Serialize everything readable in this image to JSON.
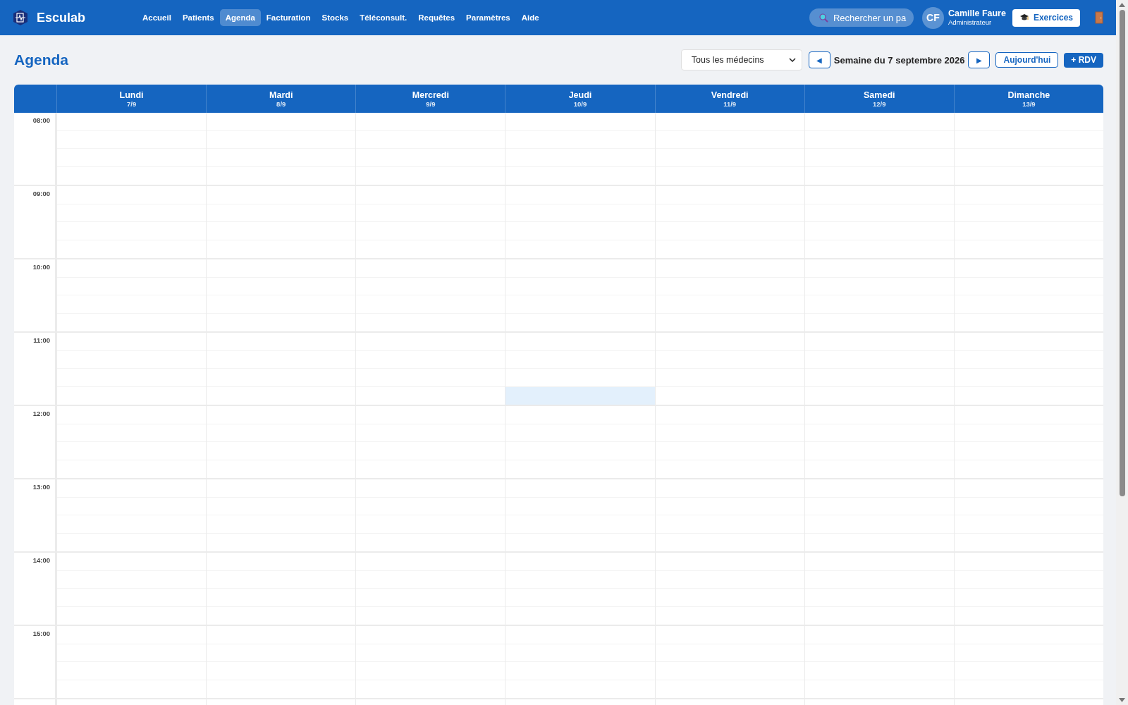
{
  "app": {
    "name": "Esculab"
  },
  "nav": [
    {
      "label": "Accueil",
      "selected": false
    },
    {
      "label": "Patients",
      "selected": false
    },
    {
      "label": "Agenda",
      "selected": true
    },
    {
      "label": "Facturation",
      "selected": false
    },
    {
      "label": "Stocks",
      "selected": false
    },
    {
      "label": "Téléconsult.",
      "selected": false
    },
    {
      "label": "Requêtes",
      "selected": false
    },
    {
      "label": "Paramètres",
      "selected": false
    },
    {
      "label": "Aide",
      "selected": false
    }
  ],
  "search": {
    "placeholder": "Rechercher un pa"
  },
  "user": {
    "initials": "CF",
    "name": "Camille Faure",
    "role": "Administrateur"
  },
  "exercises_button": "Exercices",
  "page_title": "Agenda",
  "doctor_filter": {
    "value": "Tous les médecins"
  },
  "week_label": "Semaine du 7 septembre 2026",
  "prev_button": "◀",
  "next_button": "▶",
  "today_button": "Aujourd'hui",
  "new_button": "+ RDV",
  "days": [
    {
      "name": "Lundi",
      "date": "7/9"
    },
    {
      "name": "Mardi",
      "date": "8/9"
    },
    {
      "name": "Mercredi",
      "date": "9/9"
    },
    {
      "name": "Jeudi",
      "date": "10/9"
    },
    {
      "name": "Vendredi",
      "date": "11/9"
    },
    {
      "name": "Samedi",
      "date": "12/9"
    },
    {
      "name": "Dimanche",
      "date": "13/9"
    }
  ],
  "hours": [
    {
      "label": "08:00",
      "slots_selected": [
        [
          false,
          false,
          false,
          false,
          false,
          false,
          false
        ],
        [
          false,
          false,
          false,
          false,
          false,
          false,
          false
        ],
        [
          false,
          false,
          false,
          false,
          false,
          false,
          false
        ],
        [
          false,
          false,
          false,
          false,
          false,
          false,
          false
        ]
      ]
    },
    {
      "label": "09:00",
      "slots_selected": [
        [
          false,
          false,
          false,
          false,
          false,
          false,
          false
        ],
        [
          false,
          false,
          false,
          false,
          false,
          false,
          false
        ],
        [
          false,
          false,
          false,
          false,
          false,
          false,
          false
        ],
        [
          false,
          false,
          false,
          false,
          false,
          false,
          false
        ]
      ]
    },
    {
      "label": "10:00",
      "slots_selected": [
        [
          false,
          false,
          false,
          false,
          false,
          false,
          false
        ],
        [
          false,
          false,
          false,
          false,
          false,
          false,
          false
        ],
        [
          false,
          false,
          false,
          false,
          false,
          false,
          false
        ],
        [
          false,
          false,
          false,
          false,
          false,
          false,
          false
        ]
      ]
    },
    {
      "label": "11:00",
      "slots_selected": [
        [
          false,
          false,
          false,
          false,
          false,
          false,
          false
        ],
        [
          false,
          false,
          false,
          false,
          false,
          false,
          false
        ],
        [
          false,
          false,
          false,
          false,
          false,
          false,
          false
        ],
        [
          false,
          false,
          false,
          true,
          false,
          false,
          false
        ]
      ]
    },
    {
      "label": "12:00",
      "slots_selected": [
        [
          false,
          false,
          false,
          false,
          false,
          false,
          false
        ],
        [
          false,
          false,
          false,
          false,
          false,
          false,
          false
        ],
        [
          false,
          false,
          false,
          false,
          false,
          false,
          false
        ],
        [
          false,
          false,
          false,
          false,
          false,
          false,
          false
        ]
      ]
    },
    {
      "label": "13:00",
      "slots_selected": [
        [
          false,
          false,
          false,
          false,
          false,
          false,
          false
        ],
        [
          false,
          false,
          false,
          false,
          false,
          false,
          false
        ],
        [
          false,
          false,
          false,
          false,
          false,
          false,
          false
        ],
        [
          false,
          false,
          false,
          false,
          false,
          false,
          false
        ]
      ]
    },
    {
      "label": "14:00",
      "slots_selected": [
        [
          false,
          false,
          false,
          false,
          false,
          false,
          false
        ],
        [
          false,
          false,
          false,
          false,
          false,
          false,
          false
        ],
        [
          false,
          false,
          false,
          false,
          false,
          false,
          false
        ],
        [
          false,
          false,
          false,
          false,
          false,
          false,
          false
        ]
      ]
    },
    {
      "label": "15:00",
      "slots_selected": [
        [
          false,
          false,
          false,
          false,
          false,
          false,
          false
        ],
        [
          false,
          false,
          false,
          false,
          false,
          false,
          false
        ],
        [
          false,
          false,
          false,
          false,
          false,
          false,
          false
        ],
        [
          false,
          false,
          false,
          false,
          false,
          false,
          false
        ]
      ]
    }
  ]
}
